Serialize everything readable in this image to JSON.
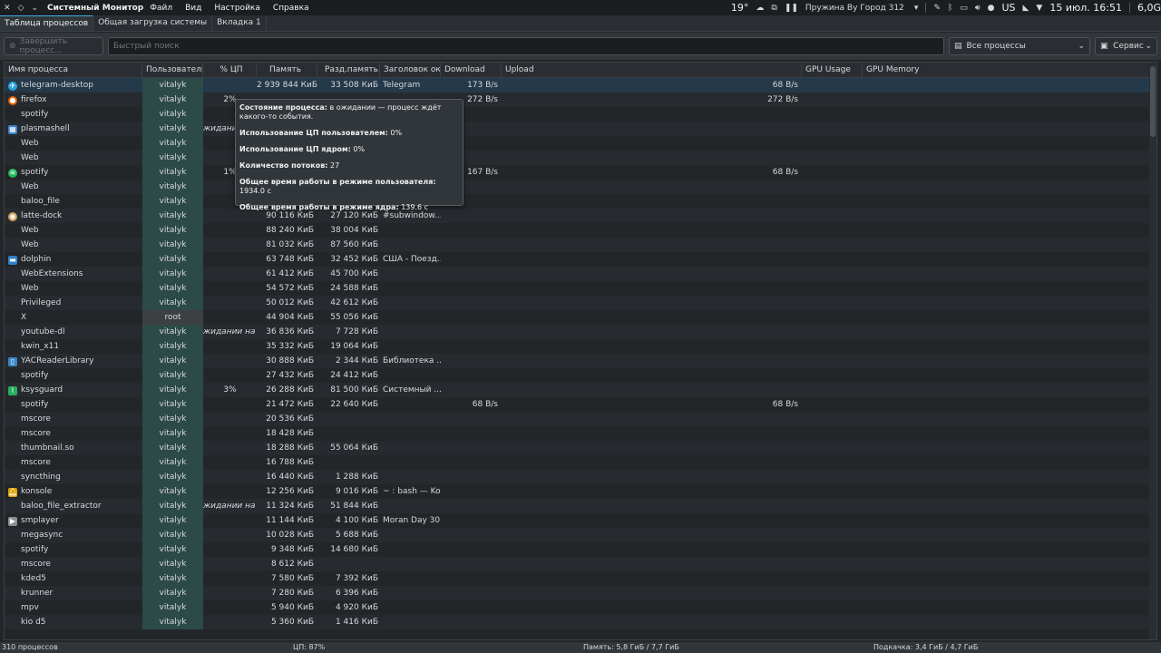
{
  "panel": {
    "app_title": "Системный Монитор",
    "menus": [
      "Файл",
      "Вид",
      "Настройка",
      "Справка"
    ],
    "weather": "19°",
    "media": "Пружина By Город 312",
    "keyboard_layout": "US",
    "clock": "15 июл. 16:51",
    "tray_extra": "6,0G"
  },
  "tabs": [
    "Таблица процессов",
    "Общая загрузка системы",
    "Вкладка 1"
  ],
  "toolbar": {
    "end_process": "Завершить процесс...",
    "search_placeholder": "Быстрый поиск",
    "filter": "Все процессы",
    "tools": "Сервис"
  },
  "columns": [
    "Имя процесса",
    "Пользователь",
    "% ЦП",
    "Память",
    "Разд.память",
    "Заголовок окна",
    "Download",
    "Upload",
    "GPU Usage",
    "GPU Memory"
  ],
  "rows": [
    {
      "name": "telegram-desktop",
      "icon": "telegram",
      "user": "vitalyk",
      "cpu": "",
      "mem": "2 939 844 КиБ",
      "shared": "33 508 КиБ",
      "title": "Telegram",
      "down": "173 B/s",
      "up": "68 B/s"
    },
    {
      "name": "firefox",
      "icon": "firefox",
      "user": "vitalyk",
      "cpu": "2%",
      "mem": "",
      "shared": "",
      "title": "",
      "down": "272 B/s",
      "up": "272 B/s"
    },
    {
      "name": "spotify",
      "icon": "",
      "user": "vitalyk",
      "cpu": "",
      "mem": "",
      "shared": "",
      "title": "",
      "down": "",
      "up": ""
    },
    {
      "name": "plasmashell",
      "icon": "plasma",
      "user": "vitalyk",
      "cpu": "жидании",
      "mem": "",
      "shared": "",
      "title": "",
      "down": "",
      "up": ""
    },
    {
      "name": "Web",
      "icon": "",
      "user": "vitalyk",
      "cpu": "",
      "mem": "",
      "shared": "",
      "title": "",
      "down": "",
      "up": ""
    },
    {
      "name": "Web",
      "icon": "",
      "user": "vitalyk",
      "cpu": "",
      "mem": "",
      "shared": "",
      "title": "",
      "down": "",
      "up": ""
    },
    {
      "name": "spotify",
      "icon": "spotify",
      "user": "vitalyk",
      "cpu": "1%",
      "mem": "",
      "shared": "",
      "title": "",
      "down": "167 B/s",
      "up": "68 B/s"
    },
    {
      "name": "Web",
      "icon": "",
      "user": "vitalyk",
      "cpu": "",
      "mem": "",
      "shared": "",
      "title": "",
      "down": "",
      "up": ""
    },
    {
      "name": "baloo_file",
      "icon": "",
      "user": "vitalyk",
      "cpu": "",
      "mem": "",
      "shared": "",
      "title": "",
      "down": "",
      "up": ""
    },
    {
      "name": "latte-dock",
      "icon": "latte",
      "user": "vitalyk",
      "cpu": "",
      "mem": "90 116 КиБ",
      "shared": "27 120 КиБ",
      "title": "#subwindow...",
      "down": "",
      "up": ""
    },
    {
      "name": "Web",
      "icon": "",
      "user": "vitalyk",
      "cpu": "",
      "mem": "88 240 КиБ",
      "shared": "38 004 КиБ",
      "title": "",
      "down": "",
      "up": ""
    },
    {
      "name": "Web",
      "icon": "",
      "user": "vitalyk",
      "cpu": "",
      "mem": "81 032 КиБ",
      "shared": "87 560 КиБ",
      "title": "",
      "down": "",
      "up": ""
    },
    {
      "name": "dolphin",
      "icon": "dolphin",
      "user": "vitalyk",
      "cpu": "",
      "mem": "63 748 КиБ",
      "shared": "32 452 КиБ",
      "title": "США - Поезд...",
      "down": "",
      "up": ""
    },
    {
      "name": "WebExtensions",
      "icon": "",
      "user": "vitalyk",
      "cpu": "",
      "mem": "61 412 КиБ",
      "shared": "45 700 КиБ",
      "title": "",
      "down": "",
      "up": ""
    },
    {
      "name": "Web",
      "icon": "",
      "user": "vitalyk",
      "cpu": "",
      "mem": "54 572 КиБ",
      "shared": "24 588 КиБ",
      "title": "",
      "down": "",
      "up": ""
    },
    {
      "name": "Privileged",
      "icon": "",
      "user": "vitalyk",
      "cpu": "",
      "mem": "50 012 КиБ",
      "shared": "42 612 КиБ",
      "title": "",
      "down": "",
      "up": ""
    },
    {
      "name": "X",
      "icon": "",
      "user": "root",
      "cpu": "",
      "mem": "44 904 КиБ",
      "shared": "55 056 КиБ",
      "title": "",
      "down": "",
      "up": ""
    },
    {
      "name": "youtube-dl",
      "icon": "",
      "user": "vitalyk",
      "cpu": "жидании на ди",
      "mem": "36 836 КиБ",
      "shared": "7 728 КиБ",
      "title": "",
      "down": "",
      "up": ""
    },
    {
      "name": "kwin_x11",
      "icon": "",
      "user": "vitalyk",
      "cpu": "",
      "mem": "35 332 КиБ",
      "shared": "19 064 КиБ",
      "title": "",
      "down": "",
      "up": ""
    },
    {
      "name": "YACReaderLibrary",
      "icon": "yac",
      "user": "vitalyk",
      "cpu": "",
      "mem": "30 888 КиБ",
      "shared": "2 344 КиБ",
      "title": "Библиотека ...",
      "down": "",
      "up": ""
    },
    {
      "name": "spotify",
      "icon": "",
      "user": "vitalyk",
      "cpu": "",
      "mem": "27 432 КиБ",
      "shared": "24 412 КиБ",
      "title": "",
      "down": "",
      "up": ""
    },
    {
      "name": "ksysguard",
      "icon": "ksysguard",
      "user": "vitalyk",
      "cpu": "3%",
      "mem": "26 288 КиБ",
      "shared": "81 500 КиБ",
      "title": "Системный ...",
      "down": "",
      "up": ""
    },
    {
      "name": "spotify",
      "icon": "",
      "user": "vitalyk",
      "cpu": "",
      "mem": "21 472 КиБ",
      "shared": "22 640 КиБ",
      "title": "",
      "down": "68 B/s",
      "up": "68 B/s"
    },
    {
      "name": "mscore",
      "icon": "",
      "user": "vitalyk",
      "cpu": "",
      "mem": "20 536 КиБ",
      "shared": "",
      "title": "",
      "down": "",
      "up": ""
    },
    {
      "name": "mscore",
      "icon": "",
      "user": "vitalyk",
      "cpu": "",
      "mem": "18 428 КиБ",
      "shared": "",
      "title": "",
      "down": "",
      "up": ""
    },
    {
      "name": "thumbnail.so",
      "icon": "",
      "user": "vitalyk",
      "cpu": "",
      "mem": "18 288 КиБ",
      "shared": "55 064 КиБ",
      "title": "",
      "down": "",
      "up": ""
    },
    {
      "name": "mscore",
      "icon": "",
      "user": "vitalyk",
      "cpu": "",
      "mem": "16 788 КиБ",
      "shared": "",
      "title": "",
      "down": "",
      "up": ""
    },
    {
      "name": "syncthing",
      "icon": "",
      "user": "vitalyk",
      "cpu": "",
      "mem": "16 440 КиБ",
      "shared": "1 288 КиБ",
      "title": "",
      "down": "",
      "up": ""
    },
    {
      "name": "konsole",
      "icon": "konsole",
      "user": "vitalyk",
      "cpu": "",
      "mem": "12 256 КиБ",
      "shared": "9 016 КиБ",
      "title": "~ : bash — Ko...",
      "down": "",
      "up": ""
    },
    {
      "name": "baloo_file_extractor",
      "icon": "",
      "user": "vitalyk",
      "cpu": "жидании на ди",
      "mem": "11 324 КиБ",
      "shared": "51 844 КиБ",
      "title": "",
      "down": "",
      "up": ""
    },
    {
      "name": "smplayer",
      "icon": "smplayer",
      "user": "vitalyk",
      "cpu": "",
      "mem": "11 144 КиБ",
      "shared": "4 100 КиБ",
      "title": "Moran Day 30...",
      "down": "",
      "up": ""
    },
    {
      "name": "megasync",
      "icon": "",
      "user": "vitalyk",
      "cpu": "",
      "mem": "10 028 КиБ",
      "shared": "5 688 КиБ",
      "title": "",
      "down": "",
      "up": ""
    },
    {
      "name": "spotify",
      "icon": "",
      "user": "vitalyk",
      "cpu": "",
      "mem": "9 348 КиБ",
      "shared": "14 680 КиБ",
      "title": "",
      "down": "",
      "up": ""
    },
    {
      "name": "mscore",
      "icon": "",
      "user": "vitalyk",
      "cpu": "",
      "mem": "8 612 КиБ",
      "shared": "",
      "title": "",
      "down": "",
      "up": ""
    },
    {
      "name": "kded5",
      "icon": "",
      "user": "vitalyk",
      "cpu": "",
      "mem": "7 580 КиБ",
      "shared": "7 392 КиБ",
      "title": "",
      "down": "",
      "up": ""
    },
    {
      "name": "krunner",
      "icon": "",
      "user": "vitalyk",
      "cpu": "",
      "mem": "7 280 КиБ",
      "shared": "6 396 КиБ",
      "title": "",
      "down": "",
      "up": ""
    },
    {
      "name": "mpv",
      "icon": "",
      "user": "vitalyk",
      "cpu": "",
      "mem": "5 940 КиБ",
      "shared": "4 920 КиБ",
      "title": "",
      "down": "",
      "up": ""
    },
    {
      "name": "kio d5",
      "icon": "",
      "user": "vitalyk",
      "cpu": "",
      "mem": "5 360 КиБ",
      "shared": "1 416 КиБ",
      "title": "",
      "down": "",
      "up": ""
    }
  ],
  "tooltip": {
    "state_label": "Состояние процесса:",
    "state_value": "в ожидании — процесс ждёт какого-то события.",
    "user_cpu_label": "Использование ЦП пользователем:",
    "user_cpu_value": "0%",
    "kernel_cpu_label": "Использование ЦП ядром:",
    "kernel_cpu_value": "0%",
    "threads_label": "Количество потоков:",
    "threads_value": "27",
    "user_time_label": "Общее время работы в режиме пользователя:",
    "user_time_value": "1934.0 с",
    "kernel_time_label": "Общее время работы в режиме ядра:",
    "kernel_time_value": "139.6 с"
  },
  "status": {
    "processes": "310 процессов",
    "cpu": "ЦП: 87%",
    "memory": "Память: 5,8 ГиБ / 7,7 ГиБ",
    "swap": "Подкачка: 3,4 ГиБ / 4,7 ГиБ"
  },
  "colors": {
    "accent": "#3daee9",
    "user_cell": "#2c4a47",
    "selected_row": "#24394a"
  }
}
